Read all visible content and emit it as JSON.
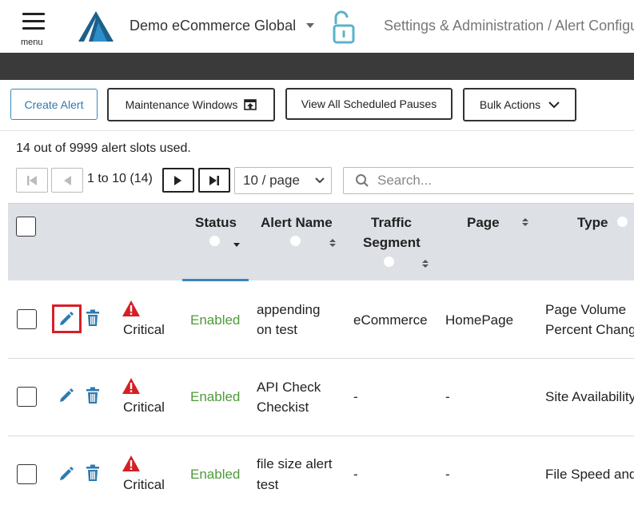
{
  "header": {
    "menu_label": "menu",
    "account_name": "Demo eCommerce Global",
    "breadcrumb": "Settings & Administration / Alert Configuration"
  },
  "toolbar": {
    "create_alert": "Create Alert",
    "maintenance_windows": "Maintenance Windows",
    "view_scheduled_pauses": "View All Scheduled Pauses",
    "bulk_actions": "Bulk Actions"
  },
  "slots_text": "14 out of 9999 alert slots used.",
  "pager": {
    "range": "1 to 10 (14)",
    "per_page": "10 / page"
  },
  "search": {
    "placeholder": "Search..."
  },
  "columns": {
    "status": "Status",
    "alert_name": "Alert Name",
    "traffic_segment_1": "Traffic",
    "traffic_segment_2": "Segment",
    "page": "Page",
    "type": "Type"
  },
  "rows": [
    {
      "severity": "Critical",
      "status": "Enabled",
      "name_1": "appending",
      "name_2": "on test",
      "segment": "eCommerce",
      "page": "HomePage",
      "type_1": "Page Volume",
      "type_2": "Percent Change"
    },
    {
      "severity": "Critical",
      "status": "Enabled",
      "name_1": "API Check",
      "name_2": "Checkist",
      "segment": "-",
      "page": "-",
      "type_1": "Site Availability",
      "type_2": ""
    },
    {
      "severity": "Critical",
      "status": "Enabled",
      "name_1": "file size alert",
      "name_2": "test",
      "segment": "-",
      "page": "-",
      "type_1": "File Speed and",
      "type_2": ""
    }
  ],
  "colors": {
    "accent": "#3a86b8",
    "enabled": "#4f9a3a",
    "critical": "#d61f26",
    "header_dark": "#3a3a3a",
    "table_header": "#dde0e5"
  },
  "icons": [
    "menu-icon",
    "brand-logo",
    "lock-open-icon",
    "upload-icon",
    "chevron-down-icon",
    "first-page-icon",
    "prev-page-icon",
    "next-page-icon",
    "last-page-icon",
    "search-icon",
    "info-icon",
    "sort-icon",
    "edit-pencil-icon",
    "trash-icon",
    "warning-icon"
  ]
}
